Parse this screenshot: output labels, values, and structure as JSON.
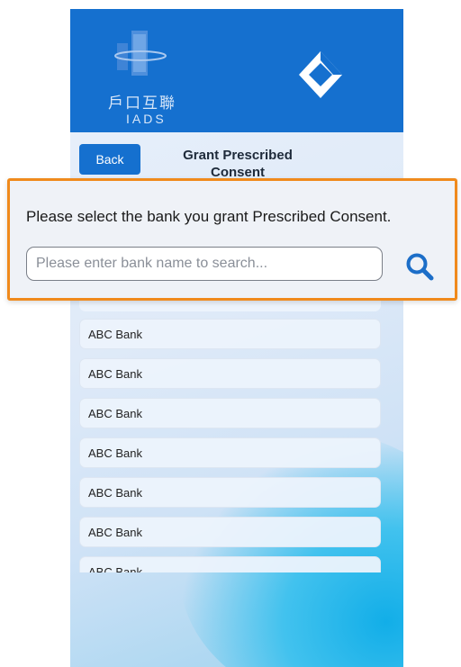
{
  "header": {
    "logo_cn": "戶口互聯",
    "logo_en": "IADS"
  },
  "toolbar": {
    "back_label": "Back",
    "title": "Grant Prescribed Consent"
  },
  "overlay": {
    "instruction": "Please select the bank you grant Prescribed Consent.",
    "search_placeholder": "Please enter bank name to search...",
    "search_value": ""
  },
  "banks": [
    {
      "label": "ABC Bank"
    },
    {
      "label": "ABC Bank"
    },
    {
      "label": "ABC Bank"
    },
    {
      "label": "ABC Bank"
    },
    {
      "label": "ABC Bank"
    },
    {
      "label": "ABC Bank"
    },
    {
      "label": "ABC Bank"
    }
  ],
  "colors": {
    "brand_blue": "#1570cf",
    "highlight_orange": "#f08a1c",
    "search_icon": "#1c6ec8"
  },
  "icons": {
    "logo_left": "iads-logo-icon",
    "logo_right": "bank-logo-icon",
    "search": "search-icon"
  }
}
